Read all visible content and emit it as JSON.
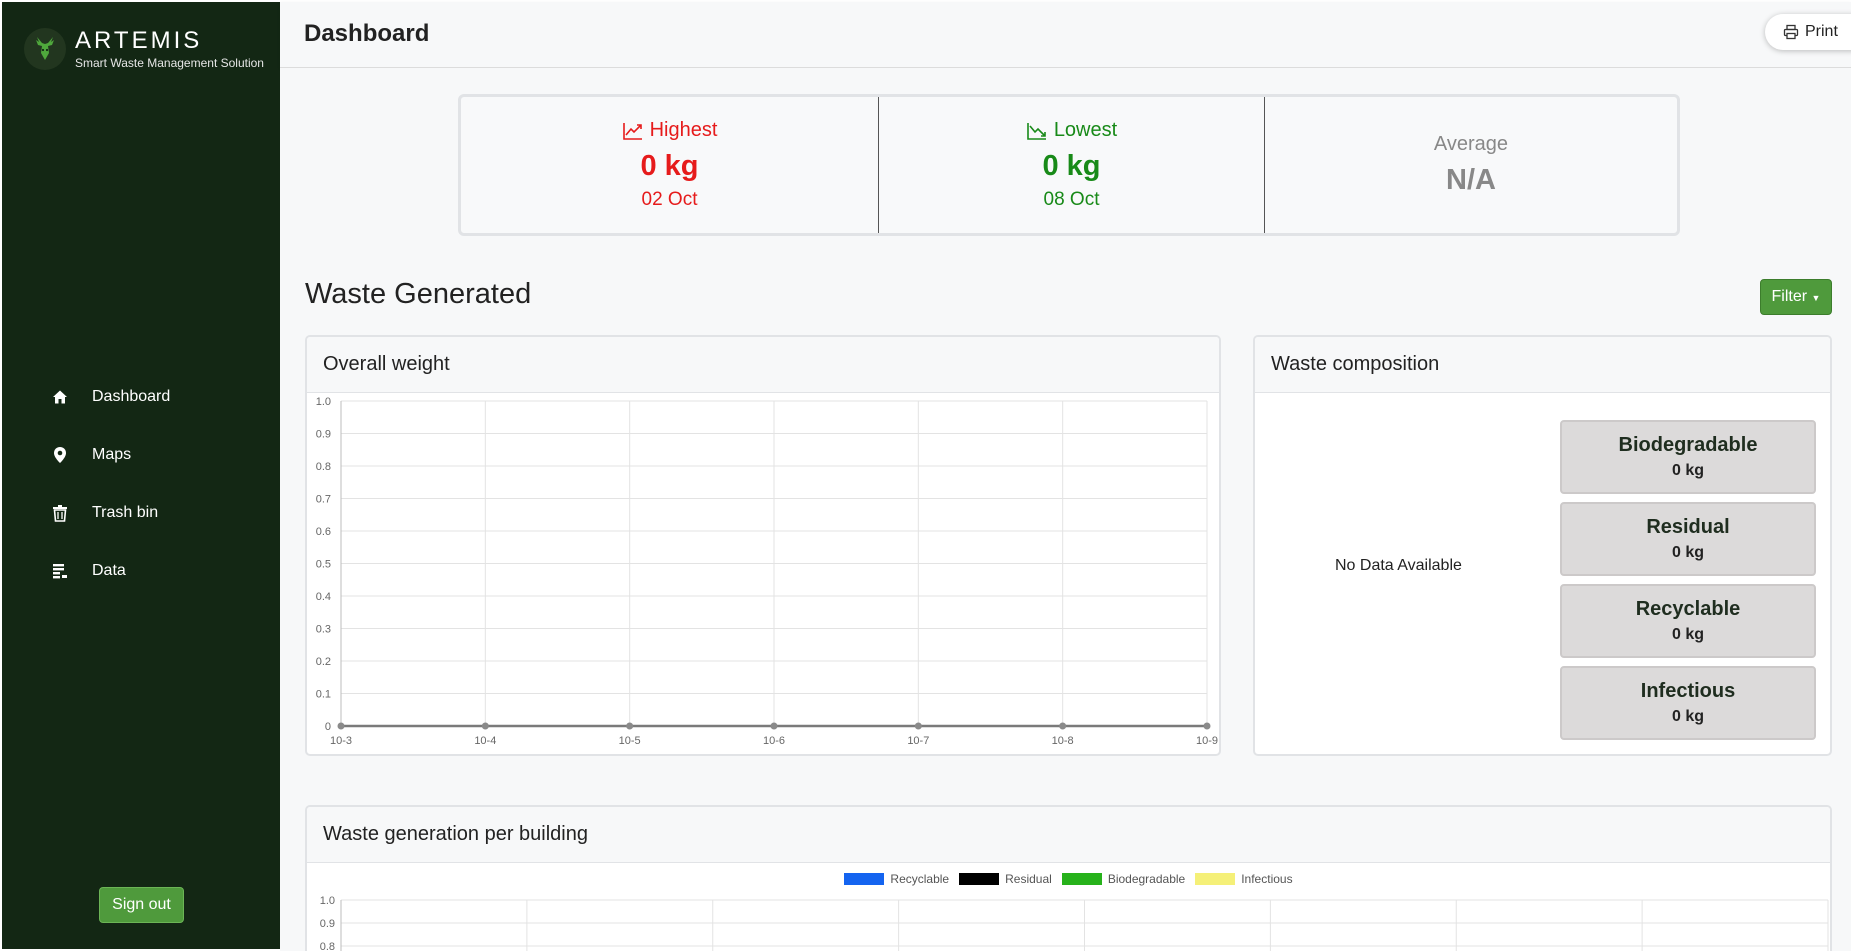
{
  "brand": {
    "name": "ARTEMIS",
    "tagline": "Smart Waste Management Solution"
  },
  "nav": {
    "items": [
      {
        "label": "Dashboard",
        "icon": "home-icon"
      },
      {
        "label": "Maps",
        "icon": "map-pin-icon"
      },
      {
        "label": "Trash bin",
        "icon": "trash-icon"
      },
      {
        "label": "Data",
        "icon": "data-icon"
      }
    ],
    "signout_label": "Sign out"
  },
  "header": {
    "title": "Dashboard",
    "print_label": "Print"
  },
  "stats": {
    "highest": {
      "label": "Highest",
      "value": "0 kg",
      "date": "02 Oct",
      "color": "#e61b1b"
    },
    "lowest": {
      "label": "Lowest",
      "value": "0 kg",
      "date": "08 Oct",
      "color": "#188a18"
    },
    "average": {
      "label": "Average",
      "value": "N/A"
    }
  },
  "waste": {
    "title": "Waste Generated",
    "filter_label": "Filter"
  },
  "overall": {
    "title": "Overall weight"
  },
  "composition": {
    "title": "Waste composition",
    "empty_text": "No Data Available",
    "items": [
      {
        "name": "Biodegradable",
        "value": "0 kg"
      },
      {
        "name": "Residual",
        "value": "0 kg"
      },
      {
        "name": "Recyclable",
        "value": "0 kg"
      },
      {
        "name": "Infectious",
        "value": "0 kg"
      }
    ]
  },
  "per_building": {
    "title": "Waste generation per building",
    "legend": [
      {
        "name": "Recyclable",
        "color": "#1464f0"
      },
      {
        "name": "Residual",
        "color": "#000000"
      },
      {
        "name": "Biodegradable",
        "color": "#27b21b"
      },
      {
        "name": "Infectious",
        "color": "#f5f078"
      }
    ],
    "ticks": [
      "1.0",
      "0.9",
      "0.8"
    ]
  },
  "chart_data": [
    {
      "type": "line",
      "x": [
        "10-3",
        "10-4",
        "10-5",
        "10-6",
        "10-7",
        "10-8",
        "10-9"
      ],
      "series": [
        {
          "values": [
            0,
            0,
            0,
            0,
            0,
            0,
            0
          ]
        }
      ],
      "yticks": [
        "1.0",
        "0.9",
        "0.8",
        "0.7",
        "0.6",
        "0.5",
        "0.4",
        "0.3",
        "0.2",
        "0.1",
        "0"
      ],
      "ylim": [
        0,
        1.0
      ],
      "grid": true
    }
  ]
}
